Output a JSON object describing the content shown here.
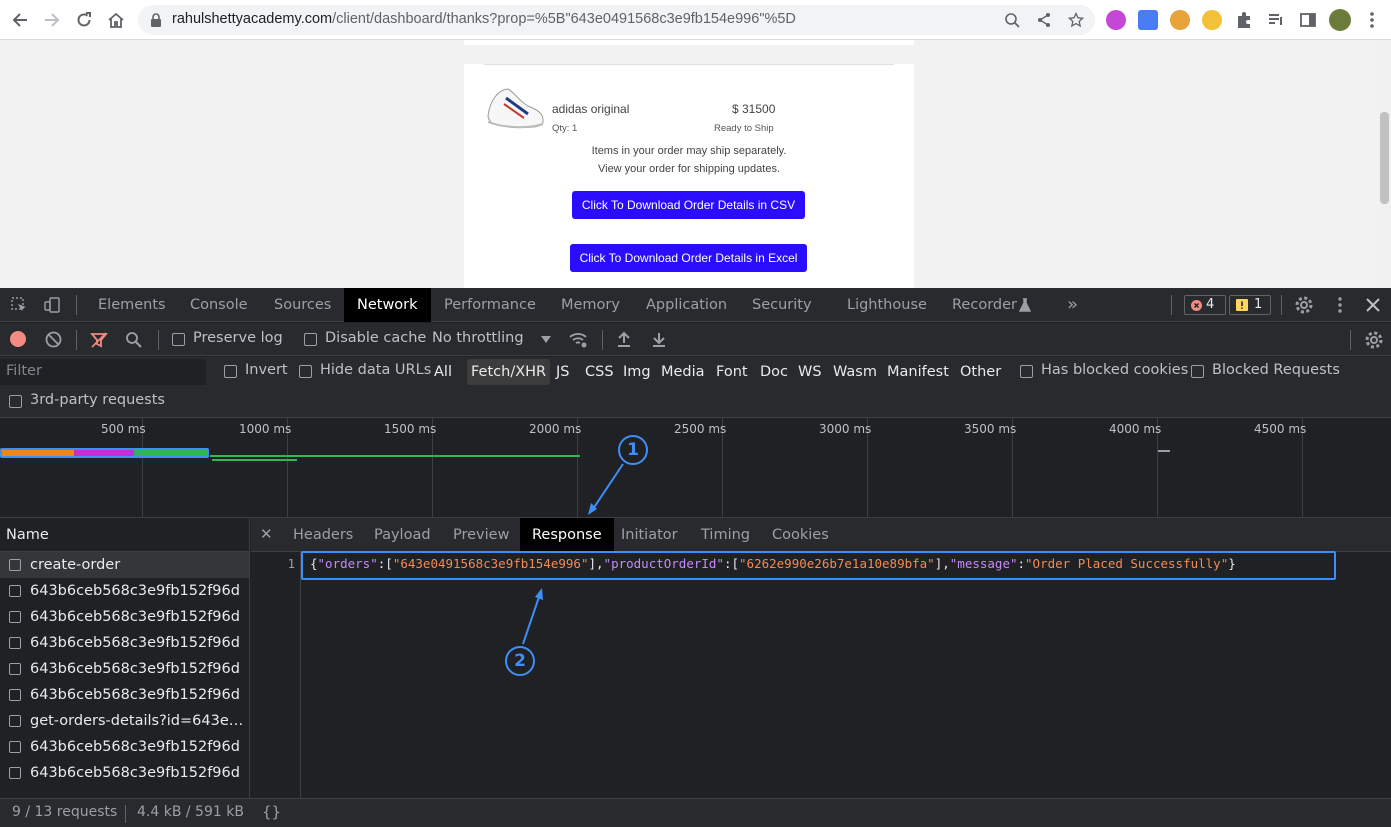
{
  "browser": {
    "url_host": "rahulshettyacademy.com",
    "url_path": "/client/dashboard/thanks?prop=%5B\"643e0491568c3e9fb154e996\"%5D"
  },
  "page": {
    "product_name": "adidas original",
    "product_price": "$ 31500",
    "qty": "Qty: 1",
    "ready": "Ready to Ship",
    "note1": "Items in your order may ship separately.",
    "note2": "View your order for shipping updates.",
    "csv_button": "Click To Download Order Details in CSV",
    "excel_button": "Click To Download Order Details in Excel"
  },
  "devtools": {
    "tabs": [
      "Elements",
      "Console",
      "Sources",
      "Network",
      "Performance",
      "Memory",
      "Application",
      "Security",
      "Lighthouse",
      "Recorder"
    ],
    "more": "»",
    "error_count": "4",
    "warning_count": "1",
    "toolbar": {
      "preserve_log": "Preserve log",
      "disable_cache": "Disable cache",
      "throttling": "No throttling"
    },
    "filter": {
      "placeholder": "Filter",
      "invert": "Invert",
      "hide_data_urls": "Hide data URLs",
      "types": [
        "All",
        "Fetch/XHR",
        "JS",
        "CSS",
        "Img",
        "Media",
        "Font",
        "Doc",
        "WS",
        "Wasm",
        "Manifest",
        "Other"
      ],
      "has_blocked_cookies": "Has blocked cookies",
      "blocked_requests": "Blocked Requests",
      "third_party": "3rd-party requests"
    },
    "timeline_ticks": [
      "500 ms",
      "1000 ms",
      "1500 ms",
      "2000 ms",
      "2500 ms",
      "3000 ms",
      "3500 ms",
      "4000 ms",
      "4500 ms"
    ],
    "requests_header": "Name",
    "requests": [
      "create-order",
      "643b6ceb568c3e9fb152f96d",
      "643b6ceb568c3e9fb152f96d",
      "643b6ceb568c3e9fb152f96d",
      "643b6ceb568c3e9fb152f96d",
      "643b6ceb568c3e9fb152f96d",
      "get-orders-details?id=643e0...",
      "643b6ceb568c3e9fb152f96d",
      "643b6ceb568c3e9fb152f96d"
    ],
    "detail_close": "✕",
    "detail_tabs": [
      "Headers",
      "Payload",
      "Preview",
      "Response",
      "Initiator",
      "Timing",
      "Cookies"
    ],
    "line_number": "1",
    "response": {
      "k_orders": "\"orders\"",
      "v_orders": "\"643e0491568c3e9fb154e996\"",
      "k_product": "\"productOrderId\"",
      "v_product": "\"6262e990e26b7e1a10e89bfa\"",
      "k_message": "\"message\"",
      "v_message": "\"Order Placed Successfully\""
    },
    "status_requests": "9 / 13 requests",
    "status_size": "4.4 kB / 591 kB t",
    "pretty_print": "{}"
  },
  "annotations": [
    "1",
    "2"
  ],
  "colors": {
    "accent": "#3e8ef7",
    "button": "#2a0dff",
    "error": "#f28b82",
    "warning": "#fdd663"
  }
}
